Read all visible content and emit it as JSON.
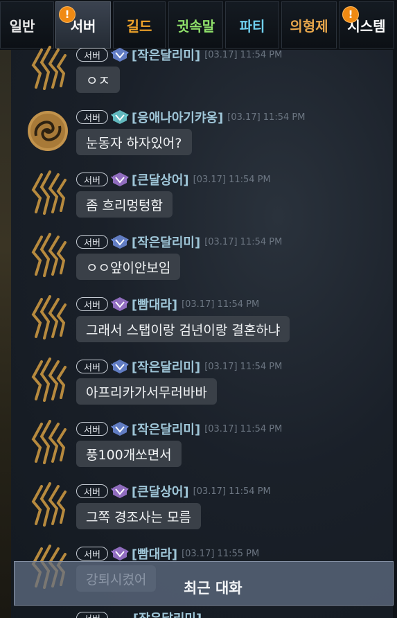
{
  "tabs": [
    {
      "label": "일반",
      "color": "#e8e8e8",
      "active": false,
      "alert": false
    },
    {
      "label": "서버",
      "color": "#ffffff",
      "active": true,
      "alert": true
    },
    {
      "label": "길드",
      "color": "#f0a42a",
      "active": false,
      "alert": false
    },
    {
      "label": "귓속말",
      "color": "#8fe06a",
      "active": false,
      "alert": false
    },
    {
      "label": "파티",
      "color": "#6fd0f0",
      "active": false,
      "alert": false
    },
    {
      "label": "의형제",
      "color": "#e7a64b",
      "active": false,
      "alert": false
    },
    {
      "label": "시스템",
      "color": "#ffffff",
      "active": false,
      "alert": true
    }
  ],
  "alert_glyph": "!",
  "server_tag": "서버",
  "messages": [
    {
      "name": "[작은달리미]",
      "time": "[03.17] 11:54 PM",
      "text": "ㅇㅈ",
      "emblem": "blue-emblem-icon",
      "avatar": "claw"
    },
    {
      "name": "[응애나아기캬옹]",
      "time": "[03.17] 11:54 PM",
      "text": "눈동자 하자있어?",
      "emblem": "teal-emblem-icon",
      "avatar": "swirl"
    },
    {
      "name": "[큰달상어]",
      "time": "[03.17] 11:54 PM",
      "text": "좀 흐리멍텅함",
      "emblem": "purple-emblem-icon",
      "avatar": "claw"
    },
    {
      "name": "[작은달리미]",
      "time": "[03.17] 11:54 PM",
      "text": "ㅇㅇ앞이안보임",
      "emblem": "blue-emblem-icon",
      "avatar": "claw"
    },
    {
      "name": "[빰대라]",
      "time": "[03.17] 11:54 PM",
      "text": "그래서 스탭이랑 검년이랑 결혼하냐",
      "emblem": "purple-emblem-icon",
      "avatar": "claw"
    },
    {
      "name": "[작은달리미]",
      "time": "[03.17] 11:54 PM",
      "text": "아프리카가서무러바바",
      "emblem": "blue-emblem-icon",
      "avatar": "claw"
    },
    {
      "name": "[작은달리미]",
      "time": "[03.17] 11:54 PM",
      "text": "풍100개쏘면서",
      "emblem": "blue-emblem-icon",
      "avatar": "claw"
    },
    {
      "name": "[큰달상어]",
      "time": "[03.17] 11:54 PM",
      "text": "그쪽 경조사는 모름",
      "emblem": "purple-emblem-icon",
      "avatar": "claw"
    },
    {
      "name": "[빰대라]",
      "time": "[03.17] 11:55 PM",
      "text": "강퇴시켰어",
      "emblem": "purple-emblem-icon",
      "avatar": "claw"
    }
  ],
  "recent_label": "최근 대화",
  "partial_name": "[작은달리미]"
}
